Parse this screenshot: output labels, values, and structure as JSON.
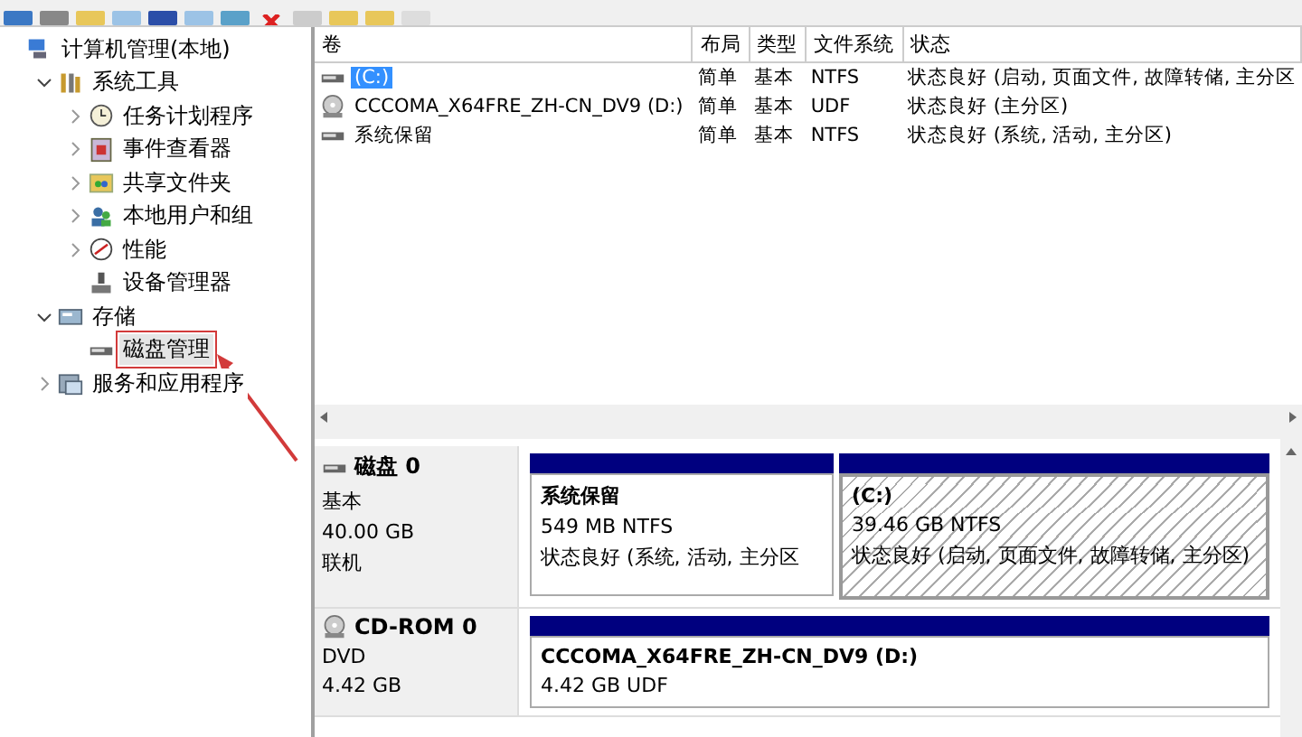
{
  "tree": {
    "items": [
      {
        "label": "计算机管理(本地)",
        "selected": false,
        "annotated": false,
        "children": [
          {
            "label": "系统工具",
            "expanded": true,
            "selected": false,
            "annotated": false,
            "children": [
              {
                "label": "任务计划程序",
                "expanded": false,
                "selected": false,
                "annotated": false
              },
              {
                "label": "事件查看器",
                "expanded": false,
                "selected": false,
                "annotated": false
              },
              {
                "label": "共享文件夹",
                "expanded": false,
                "selected": false,
                "annotated": false
              },
              {
                "label": "本地用户和组",
                "expanded": false,
                "selected": false,
                "annotated": false
              },
              {
                "label": "性能",
                "expanded": false,
                "selected": false,
                "annotated": false
              },
              {
                "label": "设备管理器",
                "selected": false,
                "annotated": false
              }
            ]
          },
          {
            "label": "存储",
            "expanded": true,
            "selected": false,
            "annotated": false,
            "children": [
              {
                "label": "磁盘管理",
                "selected": true,
                "annotated": true
              }
            ]
          },
          {
            "label": "服务和应用程序",
            "expanded": false,
            "selected": false,
            "annotated": false
          }
        ]
      }
    ]
  },
  "volumes": {
    "columns": [
      "卷",
      "布局",
      "类型",
      "文件系统",
      "状态"
    ],
    "rows": [
      {
        "kind": "disk",
        "volume": "(C:)",
        "layout": "简单",
        "type": "基本",
        "fs": "NTFS",
        "status": "状态良好 (启动, 页面文件, 故障转储, 主分区",
        "selected": true
      },
      {
        "kind": "cd",
        "volume": "CCCOMA_X64FRE_ZH-CN_DV9 (D:)",
        "layout": "简单",
        "type": "基本",
        "fs": "UDF",
        "status": "状态良好 (主分区)",
        "selected": false
      },
      {
        "kind": "disk",
        "volume": "系统保留",
        "layout": "简单",
        "type": "基本",
        "fs": "NTFS",
        "status": "状态良好 (系统, 活动, 主分区)",
        "selected": false
      }
    ]
  },
  "disks": [
    {
      "kind": "disk",
      "name": "磁盘 0",
      "lines": [
        "基本",
        "40.00 GB",
        "联机"
      ],
      "partitions": [
        {
          "name": "系统保留",
          "size": "549 MB NTFS",
          "status": "状态良好 (系统, 活动, 主分区",
          "selected": false
        },
        {
          "name": "(C:)",
          "size": "39.46 GB NTFS",
          "status": "状态良好 (启动, 页面文件, 故障转储, 主分区)",
          "selected": true
        }
      ]
    },
    {
      "kind": "cd",
      "name": "CD-ROM 0",
      "lines": [
        "DVD",
        "4.42 GB"
      ],
      "partitions": [
        {
          "name": "CCCOMA_X64FRE_ZH-CN_DV9  (D:)",
          "size": "4.42 GB UDF",
          "selected": false
        }
      ]
    }
  ]
}
